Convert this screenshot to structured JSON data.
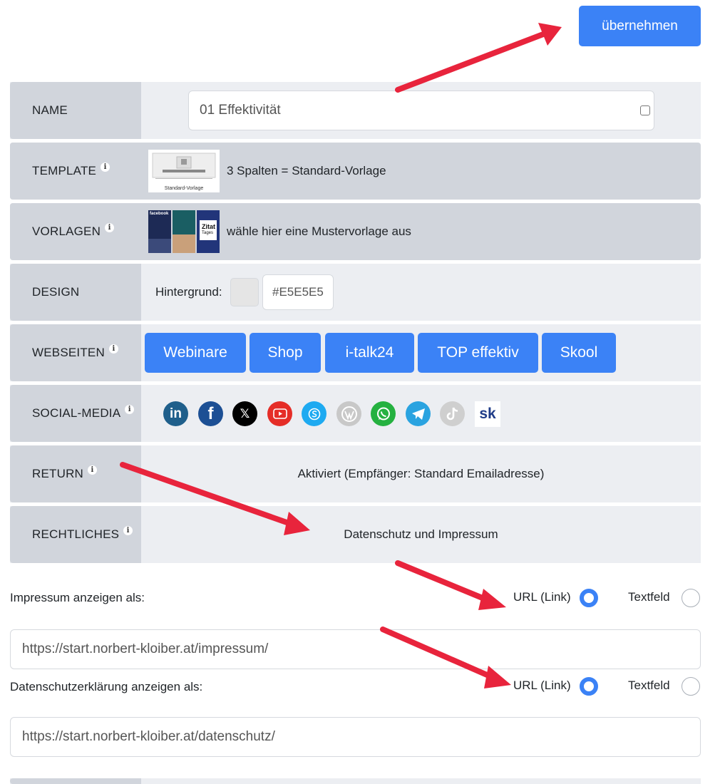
{
  "apply_button": "übernehmen",
  "rows": {
    "name": {
      "label": "NAME",
      "value": "01 Effektivität"
    },
    "template": {
      "label": "TEMPLATE",
      "thumb_caption": "Standard-Vorlage",
      "text": "3 Spalten = Standard-Vorlage"
    },
    "vorlagen": {
      "label": "VORLAGEN",
      "text": "wähle hier eine Mustervorlage aus",
      "thumb_texts": [
        "facebook",
        "Zitat",
        "Tages"
      ]
    },
    "design": {
      "label": "DESIGN",
      "bg_label": "Hintergrund:",
      "color_value": "#E5E5E5",
      "swatch_color": "#e5e5e5"
    },
    "webseiten": {
      "label": "WEBSEITEN",
      "buttons": [
        "Webinare",
        "Shop",
        "i-talk24",
        "TOP effektiv",
        "Skool"
      ]
    },
    "social": {
      "label": "SOCIAL-MEDIA",
      "icons": [
        "linkedin-icon",
        "facebook-icon",
        "x-icon",
        "youtube-icon",
        "skype-icon",
        "wordpress-icon",
        "whatsapp-icon",
        "telegram-icon",
        "tiktok-icon",
        "skool-icon"
      ],
      "linkedin_text": "in",
      "facebook_text": "f",
      "x_text": "𝕏",
      "skool_text": "sk"
    },
    "return": {
      "label": "RETURN",
      "text": "Aktiviert (Empfänger: Standard Emailadresse)"
    },
    "rechtliches": {
      "label": "RECHTLICHES",
      "text": "Datenschutz und Impressum"
    }
  },
  "info_glyph": "i",
  "impressum": {
    "label": "Impressum anzeigen als:",
    "opt_url": "URL (Link)",
    "opt_text": "Textfeld",
    "selected": "url",
    "value": "https://start.norbert-kloiber.at/impressum/"
  },
  "datenschutz": {
    "label": "Datenschutzerklärung anzeigen als:",
    "opt_url": "URL (Link)",
    "opt_text": "Textfeld",
    "selected": "url",
    "value": "https://start.norbert-kloiber.at/datenschutz/"
  },
  "colors": {
    "primary": "#3b82f6",
    "label_bg": "#d1d5dc",
    "row_bg": "#eceef2",
    "arrow": "#e8243c"
  }
}
